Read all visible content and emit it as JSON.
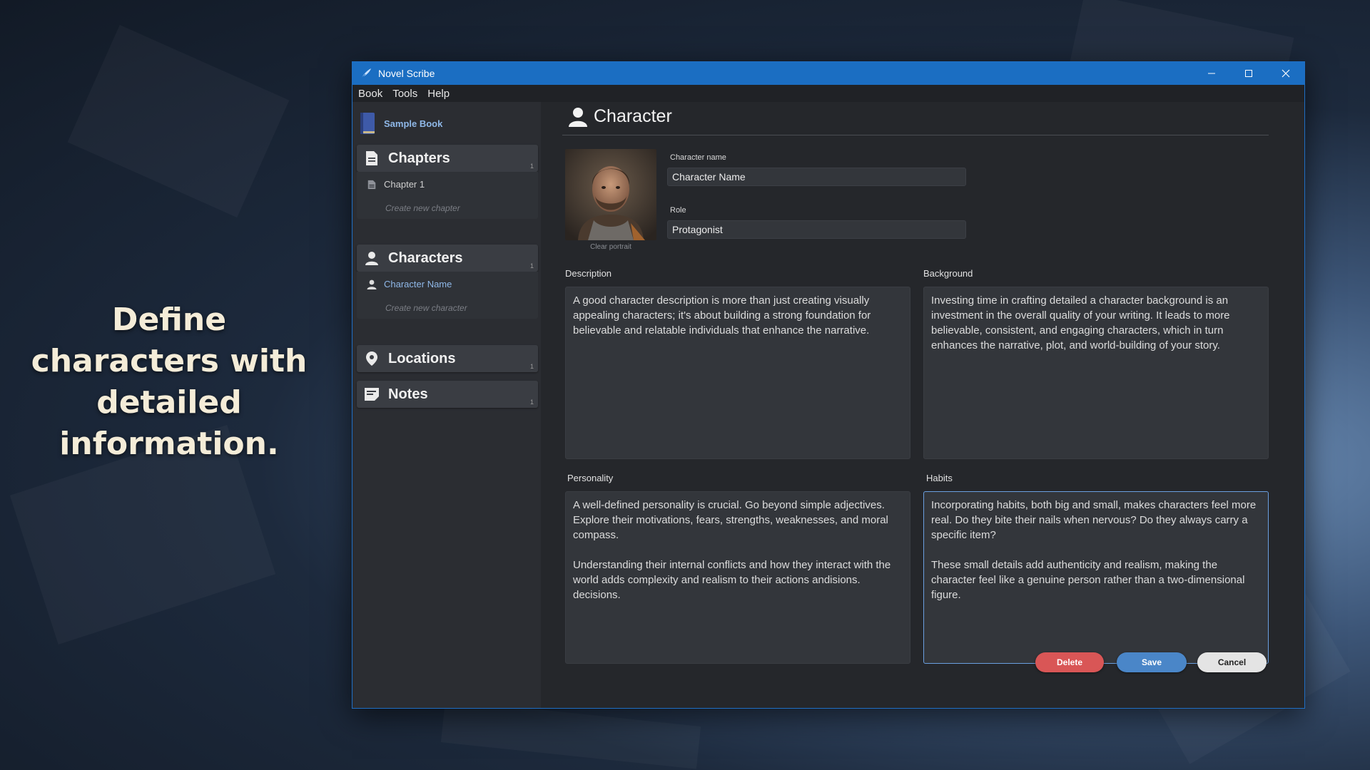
{
  "promo": {
    "text": "Define characters with detailed information."
  },
  "window": {
    "title": "Novel Scribe"
  },
  "menu": [
    "Book",
    "Tools",
    "Help"
  ],
  "sidebar": {
    "book_title": "Sample Book",
    "sections": [
      {
        "label": "Chapters",
        "count": "1",
        "items": [
          "Chapter 1"
        ],
        "create": "Create new chapter"
      },
      {
        "label": "Characters",
        "count": "1",
        "items": [
          "Character Name"
        ],
        "create": "Create new character"
      },
      {
        "label": "Locations",
        "count": "1"
      },
      {
        "label": "Notes",
        "count": "1"
      }
    ]
  },
  "editor": {
    "title": "Character",
    "clear_portrait": "Clear portrait",
    "name_label": "Character name",
    "name_value": "Character Name",
    "role_label": "Role",
    "role_value": "Protagonist",
    "description_label": "Description",
    "description": "A good character description is more than just creating visually appealing characters; it's about building a strong foundation for believable and relatable individuals that enhance the narrative.",
    "background_label": "Background",
    "background": "Investing time in crafting detailed a character background is an investment in the overall quality of your writing. It leads to more believable, consistent, and engaging characters, which in turn enhances the narrative, plot, and world-building of your story.",
    "personality_label": "Personality",
    "personality": "A well-defined personality is crucial. Go beyond simple adjectives. Explore their motivations, fears, strengths, weaknesses, and moral compass.\n\nUnderstanding their internal conflicts and how they interact with the world adds complexity and realism to their actions andisions. decisions.",
    "habits_label": "Habits",
    "habits": "Incorporating habits, both big and small, makes characters feel more real. Do they bite their nails when nervous? Do they always carry a specific item?\n\nThese small details add authenticity and realism, making the character feel like a genuine person rather than a two-dimensional figure."
  },
  "buttons": {
    "delete": "Delete",
    "save": "Save",
    "cancel": "Cancel"
  },
  "colors": {
    "titlebar": "#1b6ec2",
    "accent": "#8fb8e8",
    "delete": "#d95656",
    "save": "#4a86c8",
    "cancel": "#e4e4e4"
  }
}
